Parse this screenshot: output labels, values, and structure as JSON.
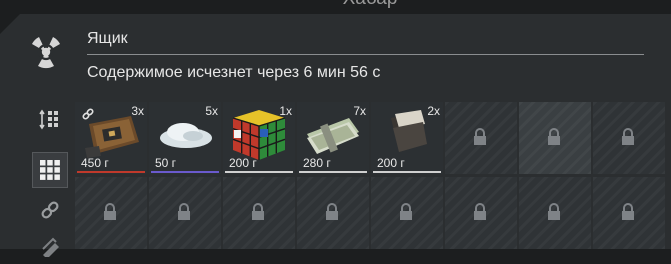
{
  "window": {
    "title": "Хабар"
  },
  "container": {
    "name": "Ящик",
    "expire_text": "Содержимое исчезнет через 6 мин 56 с",
    "icon": "radiation-hazard-icon"
  },
  "toolbar": {
    "buttons": [
      {
        "name": "sort-button",
        "icon": "sort-grid-icon"
      },
      {
        "name": "grid-view-button",
        "icon": "grid-icon",
        "active": true
      },
      {
        "name": "link-button",
        "icon": "link-icon"
      },
      {
        "name": "stack-button",
        "icon": "stack-icon"
      }
    ]
  },
  "items": [
    {
      "name": "electronics-board",
      "qty": "3x",
      "weight": "450 г",
      "underline_color": "#c0392b",
      "linked": true
    },
    {
      "name": "salt-pile",
      "qty": "5x",
      "weight": "50 г",
      "underline_color": "#6a5acd"
    },
    {
      "name": "rubiks-cube",
      "qty": "1x",
      "weight": "200 г",
      "underline_color": "#d8d8d8"
    },
    {
      "name": "money-bundle",
      "qty": "7x",
      "weight": "280 г",
      "underline_color": "#d8d8d8"
    },
    {
      "name": "wallet",
      "qty": "2x",
      "weight": "200 г",
      "underline_color": "#d8d8d8"
    }
  ],
  "locked_slot_icon": "lock-icon"
}
